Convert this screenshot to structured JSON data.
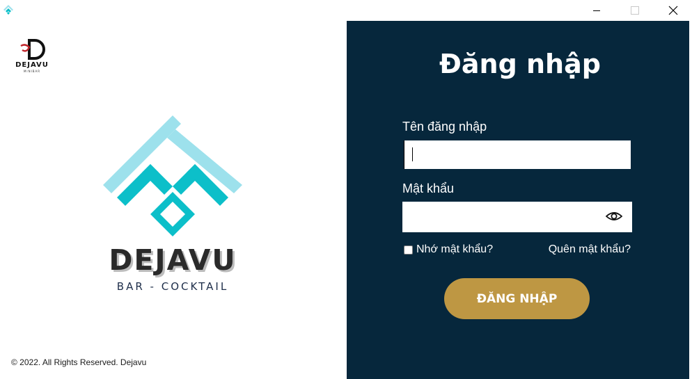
{
  "window": {
    "app_icon": "dejavu-app-icon",
    "controls": {
      "minimize": "minimize-icon",
      "maximize": "maximize-icon",
      "close": "close-icon"
    }
  },
  "branding": {
    "small_logo": {
      "name": "DEJAVU",
      "sub": "MINIBAR"
    },
    "name": "DEJAVU",
    "tagline": "BAR - COCKTAIL",
    "colors": {
      "logo_light": "#9de1ec",
      "logo_dark": "#0cbfc9"
    }
  },
  "footer": {
    "copyright": "© 2022. All Rights Reserved. Dejavu"
  },
  "login": {
    "title": "Đăng nhập",
    "username": {
      "label": "Tên đăng nhập",
      "value": "",
      "placeholder": ""
    },
    "password": {
      "label": "Mật khẩu",
      "value": "",
      "placeholder": "",
      "toggle_icon": "eye-icon"
    },
    "remember_label": "Nhớ mật khẩu?",
    "remember_checked": false,
    "forgot_label": "Quên mật khẩu?",
    "submit_label": "ĐĂNG NHẬP",
    "colors": {
      "panel_bg": "#06273c",
      "button_bg": "#be9743"
    }
  }
}
